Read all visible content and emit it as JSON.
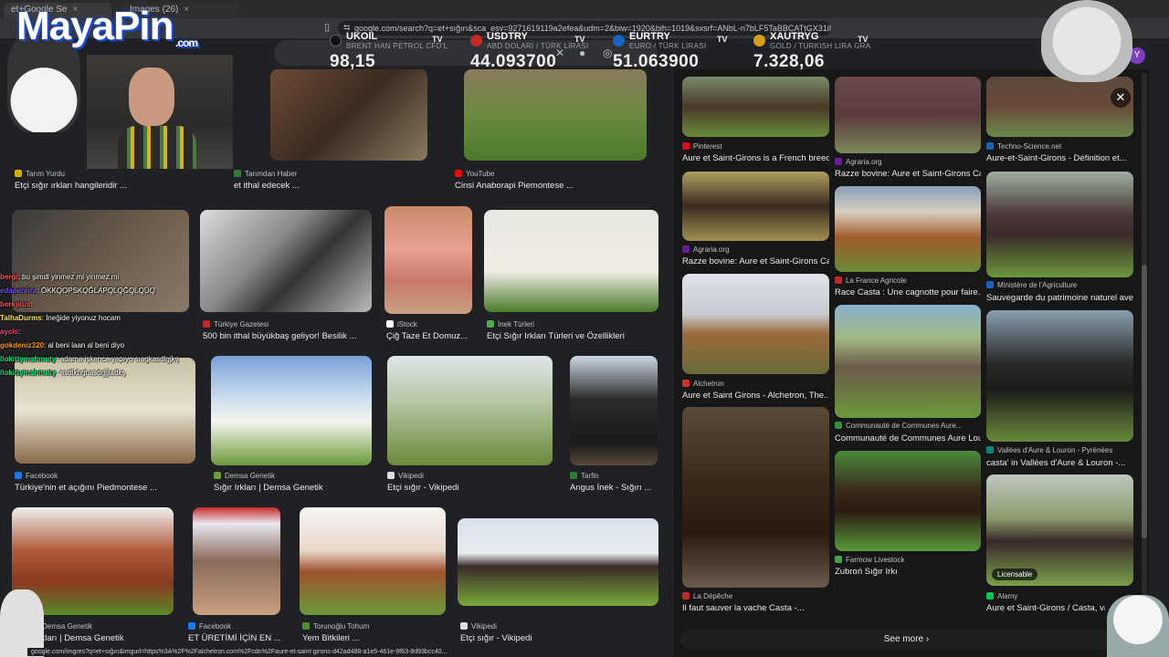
{
  "browser": {
    "tabs": [
      {
        "label": "et+Google Se"
      },
      {
        "label": "Images (26)"
      }
    ],
    "url": "google.com/search?q=et+sığırı&sca_esv=9271619119a2efea&udm=2&biw=1920&bih=1019&sxsrf=ANbL-n7bLF5TaBBCATtGX31iNOVeoM_llg...",
    "profile_initial": "Y"
  },
  "ticker": [
    {
      "symbol": "UKOIL",
      "sub": "BRENT HAN PETROL CFD'L",
      "value": "98,15",
      "color": "#111111"
    },
    {
      "symbol": "USDTRY",
      "sub": "ABD DOLARI / TÜRK LİRASI",
      "value": "44.093700",
      "color": "#c62828"
    },
    {
      "symbol": "EURTRY",
      "sub": "EURO / TÜRK LİRASI",
      "value": "51.063900",
      "color": "#1565c0"
    },
    {
      "symbol": "XAUTRYG",
      "sub": "GOLD / TURKISH LIRA GRA",
      "value": "7.328,06",
      "color": "#d4a017"
    }
  ],
  "logo": {
    "text": "MayaPin",
    "suffix": ".com"
  },
  "left_cards": [
    {
      "source": "Tarım Yurdu",
      "caption": "Etçi sığır ırkları hangileridir ...",
      "fav": "#d4b106"
    },
    {
      "source": "Tarımdan Haber",
      "caption": "et ithal edecek ...",
      "fav": "#2e7d32"
    },
    {
      "source": "YouTube",
      "caption": "Cinsi Anaborapi Piemontese ...",
      "fav": "#ff0000"
    },
    {
      "source": "Türkiye Gazetesi",
      "caption": "500 bin ithal büyükbaş geliyor! Besilik ...",
      "fav": "#c62828"
    },
    {
      "source": "iStock",
      "caption": "Çiğ Taze Et Domuz...",
      "fav": "#ffffff"
    },
    {
      "source": "İnek Türleri",
      "caption": "Etçi Sığır Irkları Türleri ve Özellikleri",
      "fav": "#4caf50"
    },
    {
      "source": "Facebook",
      "caption": "Türkiye'nin et açığını Piedmontese ...",
      "fav": "#1877f2"
    },
    {
      "source": "Demsa Genetik",
      "caption": "Sığır Irkları | Demsa Genetik",
      "fav": "#689f38"
    },
    {
      "source": "Vikipedi",
      "caption": "Etçi sığır - Vikipedi",
      "fav": "#dddddd"
    },
    {
      "source": "Tarfin",
      "caption": "Angus İnek - Sığırı ...",
      "fav": "#2e7d32"
    },
    {
      "source": "Demsa Genetik",
      "caption": "Sığır Irkları | Demsa Genetik",
      "fav": "#689f38"
    },
    {
      "source": "Facebook",
      "caption": "ET ÜRETİMİ İÇİN EN ...",
      "fav": "#1877f2"
    },
    {
      "source": "Torunoğlu Tohum",
      "caption": "Yem Bitkileri ...",
      "fav": "#558b2f"
    },
    {
      "source": "Vikipedi",
      "caption": "Etçi sığır - Vikipedi",
      "fav": "#dddddd"
    }
  ],
  "right_cards": [
    {
      "source": "Pinterest",
      "caption": "Aure et Saint-Girons is a French breed ...",
      "fav": "#e60023"
    },
    {
      "source": "Agraria.org",
      "caption": "Razze bovine: Aure et Saint-Girons Casta",
      "fav": "#6a1b9a"
    },
    {
      "source": "Techno-Science.net",
      "caption": "Aure-et-Saint-Girons - Définition et...",
      "fav": "#1565c0"
    },
    {
      "source": "Agraria.org",
      "caption": "Razze bovine: Aure et Saint-Girons Casta",
      "fav": "#6a1b9a"
    },
    {
      "source": "La France Agricole",
      "caption": "Race Casta : Une cagnotte pour faire...",
      "fav": "#c62828"
    },
    {
      "source": "Ministère de l'Agriculture",
      "caption": "Sauvegarde du patrimoine naturel avec...",
      "fav": "#1565c0"
    },
    {
      "source": "Alchetron",
      "caption": "Aure et Saint Girons - Alchetron, The...",
      "fav": "#d32f2f"
    },
    {
      "source": "Communauté de Communes Aure...",
      "caption": "Communauté de Communes Aure Louro...",
      "fav": "#388e3c"
    },
    {
      "source": "Vallées d'Aure & Louron - Pyrénées",
      "caption": "casta' in Vallées d'Aure & Louron -...",
      "fav": "#00897b"
    },
    {
      "source": "Farmow Livestock",
      "caption": "Zubroń Sığır Irkı",
      "fav": "#43a047"
    },
    {
      "source": "La Dépêche",
      "caption": "Il faut sauver la vache Casta -...",
      "fav": "#c62828"
    },
    {
      "source": "Alamy",
      "caption": "Aure et Saint-Girons / Casta, vach...",
      "fav": "#00c853"
    }
  ],
  "licensable": "Licensable",
  "see_more": "See more",
  "chat": [
    {
      "user": "bergi",
      "text": ": bu şimdi yinmez mi yinmez mi",
      "color": "#ff5252"
    },
    {
      "user": "edapereira",
      "text": ": ÖKKQOPSKQĞLAPQLQĞQLQÜQ",
      "color": "#7c4dff"
    },
    {
      "user": "berkplus",
      "text": ": ",
      "color": "#ff5252"
    },
    {
      "user": "TalhaDurms",
      "text": ": İneğide yiyonuz hocam",
      "color": "#ffeb3b"
    },
    {
      "user": "aycis",
      "text": ": ",
      "color": "#ff4081"
    },
    {
      "user": "gokdeniz320",
      "text": ": al beni laan al beni diyo",
      "color": "#ff9800"
    },
    {
      "user": "llokittymahmuty",
      "text": ": adama işkence yapıyo sıagkasdlgjkş",
      "color": "#00e676"
    },
    {
      "user": "llokittymahmuty",
      "text": ": asdlkhghasdgjjladkş",
      "color": "#00e676"
    }
  ],
  "status_url": "google.com/imgres?q=et+sığırı&imgurl=https%3A%2F%2Falchetron.com%2Fcdn%2Faure-et-saint-girons-d42ad488-a1e5-461e-9f63-8d93bcc40..."
}
